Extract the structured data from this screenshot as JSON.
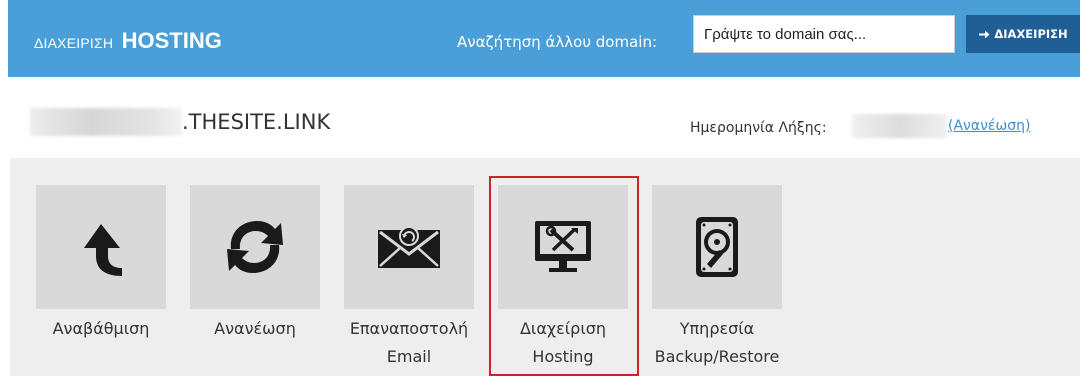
{
  "header": {
    "title_small": "ΔΙΑΧΕΙΡΙΣΗ",
    "title_big": "HOSTING",
    "search_label": "Αναζήτηση άλλου domain:",
    "search_placeholder": "Γράψτε το domain σας...",
    "manage_button_label": "ΔΙΑΧΕΙΡΙΣΗ",
    "manage_button_icon": "arrow-right-icon"
  },
  "domain": {
    "suffix": ".THESITE.LINK",
    "expiry_label": "Ημερομηνία Λήξης:",
    "renew_link": "(Ανανέωση)"
  },
  "tiles": [
    {
      "line1": "Αναβάθμιση",
      "line2": "",
      "icon": "upgrade-arrow-icon"
    },
    {
      "line1": "Ανανέωση",
      "line2": "",
      "icon": "refresh-icon"
    },
    {
      "line1": "Επαναποστολή",
      "line2": "Email",
      "icon": "resend-email-icon"
    },
    {
      "line1": "Διαχείριση",
      "line2": "Hosting",
      "icon": "hosting-tools-icon"
    },
    {
      "line1": "Υπηρεσία",
      "line2": "Backup/Restore",
      "icon": "hard-drive-icon"
    }
  ],
  "colors": {
    "header_bg": "#4b9fd8",
    "button_bg": "#1f5f95",
    "tile_bg": "#d9d9d9",
    "panel_bg": "#eeeeee",
    "highlight": "#d0202a",
    "link": "#3a8fcc"
  }
}
